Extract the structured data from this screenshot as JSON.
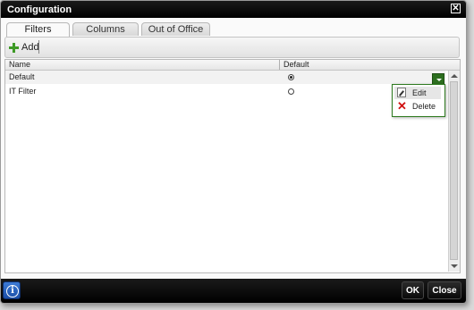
{
  "window": {
    "title": "Configuration"
  },
  "tabs": [
    {
      "label": "Filters",
      "active": true
    },
    {
      "label": "Columns",
      "active": false
    },
    {
      "label": "Out of Office",
      "active": false
    }
  ],
  "toolbar": {
    "add_label": "Add"
  },
  "grid": {
    "columns": [
      "Name",
      "Default"
    ],
    "rows": [
      {
        "name": "Default",
        "default": true
      },
      {
        "name": "IT Filter",
        "default": false
      }
    ]
  },
  "context_menu": {
    "items": [
      {
        "label": "Edit",
        "icon": "edit-icon"
      },
      {
        "label": "Delete",
        "icon": "delete-icon"
      }
    ]
  },
  "footer": {
    "ok_label": "OK",
    "close_label": "Close",
    "info_label": "i"
  },
  "colors": {
    "accent_green": "#2c6e1f",
    "titlebar": "#000000",
    "info_blue": "#1a4ea8",
    "delete_red": "#d01010"
  }
}
